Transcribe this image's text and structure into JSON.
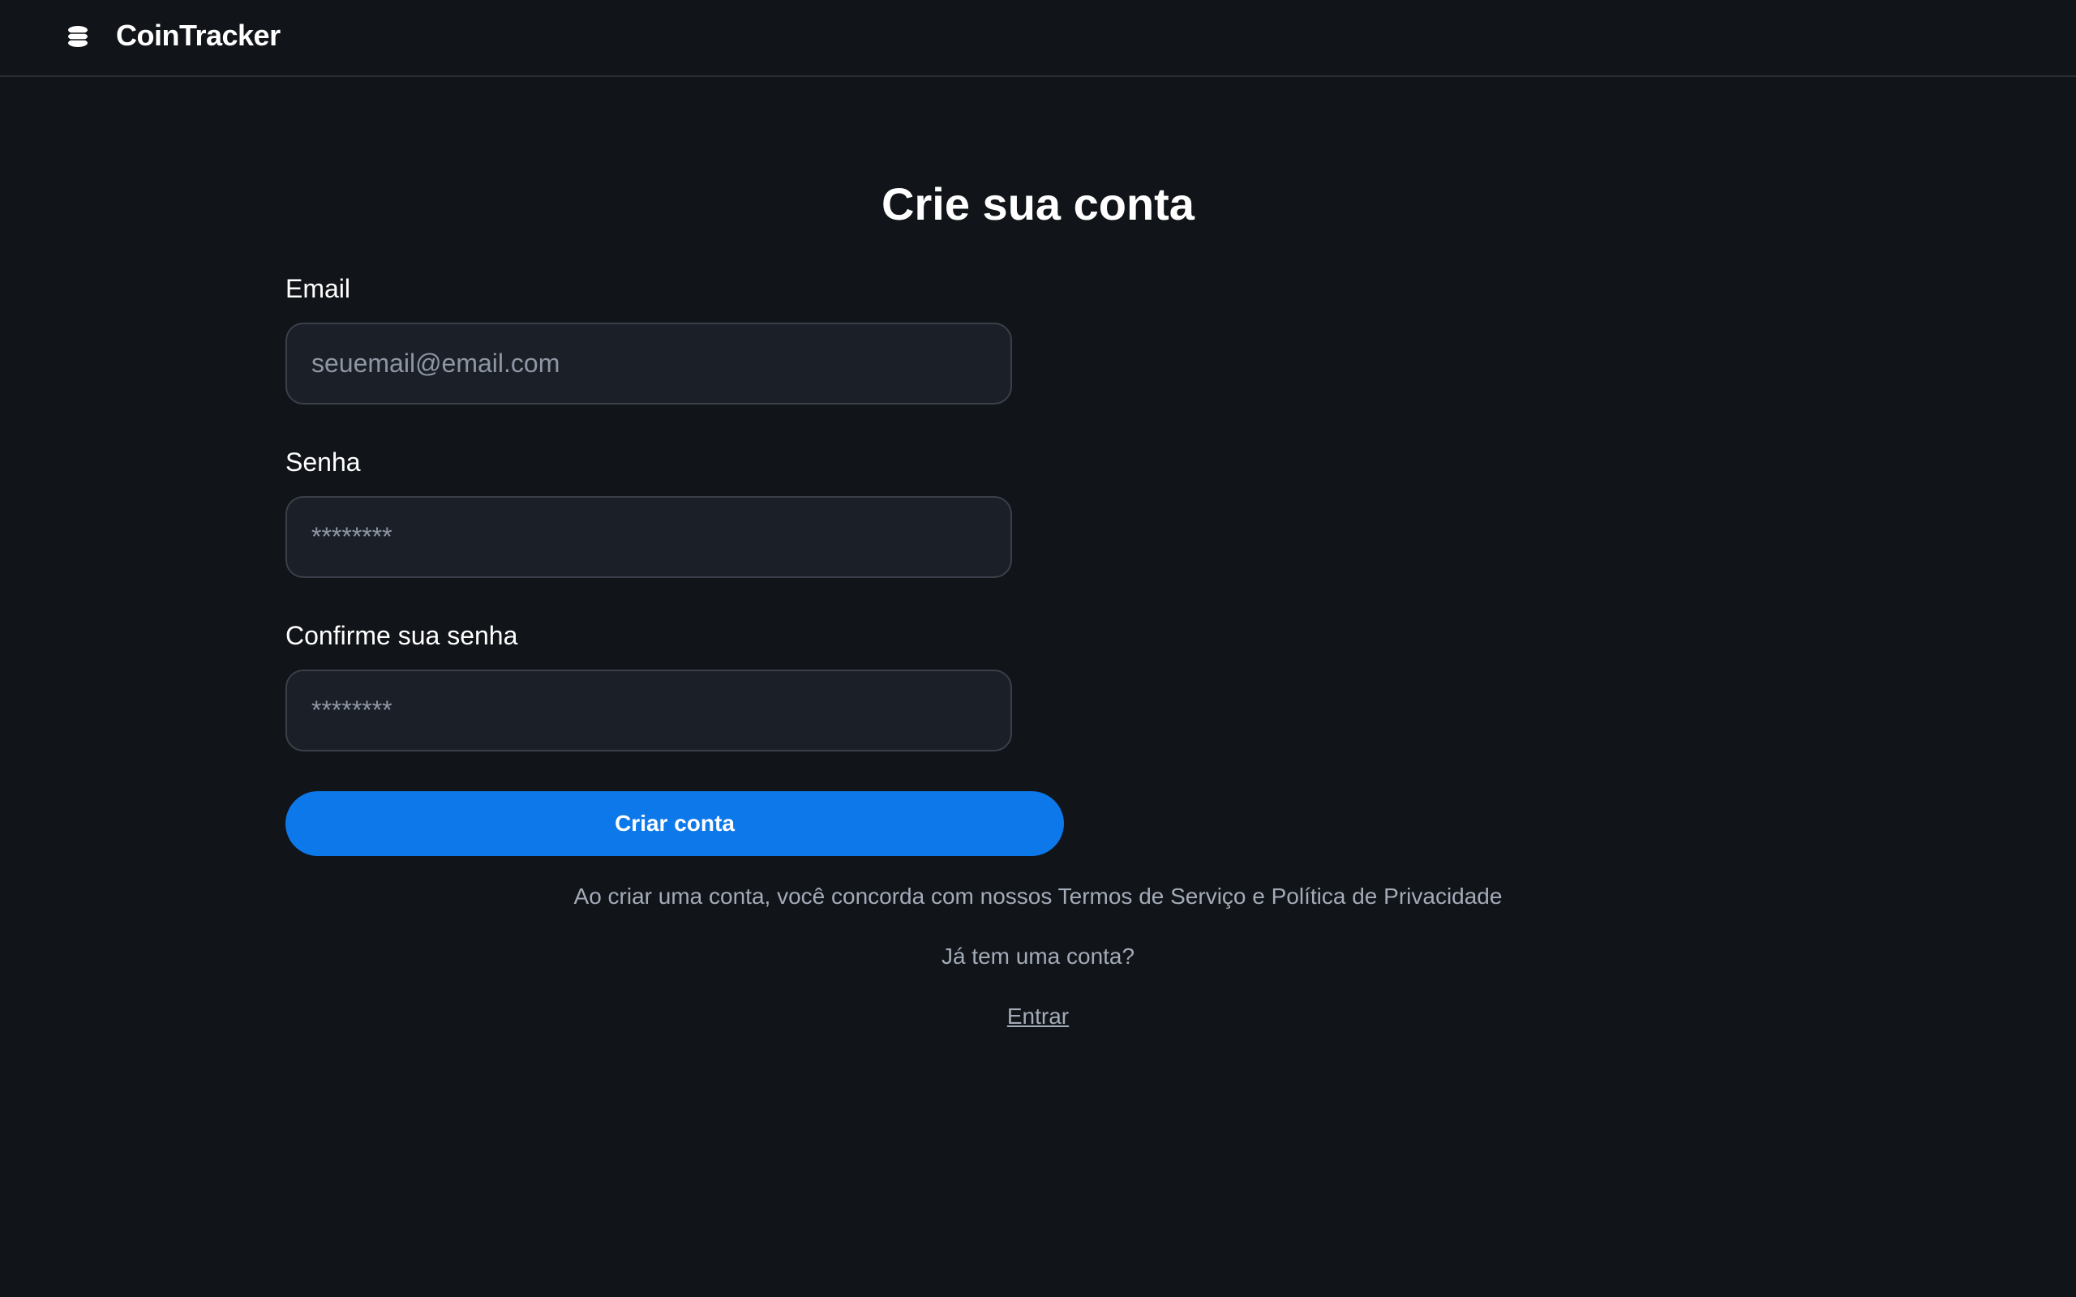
{
  "header": {
    "brand": "CoinTracker",
    "logo_icon": "coin-stack-icon"
  },
  "page": {
    "title": "Crie sua conta"
  },
  "form": {
    "email": {
      "label": "Email",
      "placeholder": "seuemail@email.com",
      "value": ""
    },
    "password": {
      "label": "Senha",
      "placeholder": "********",
      "value": ""
    },
    "confirm_password": {
      "label": "Confirme sua senha",
      "placeholder": "********",
      "value": ""
    },
    "submit_label": "Criar conta"
  },
  "footer": {
    "terms_text": "Ao criar uma conta, você concorda com nossos Termos de Serviço e Política de Privacidade",
    "have_account_text": "Já tem uma conta?",
    "login_link": "Entrar"
  },
  "colors": {
    "background": "#111418",
    "input_background": "#1b1f27",
    "accent": "#0d78ea",
    "muted_text": "#a3abb8"
  }
}
